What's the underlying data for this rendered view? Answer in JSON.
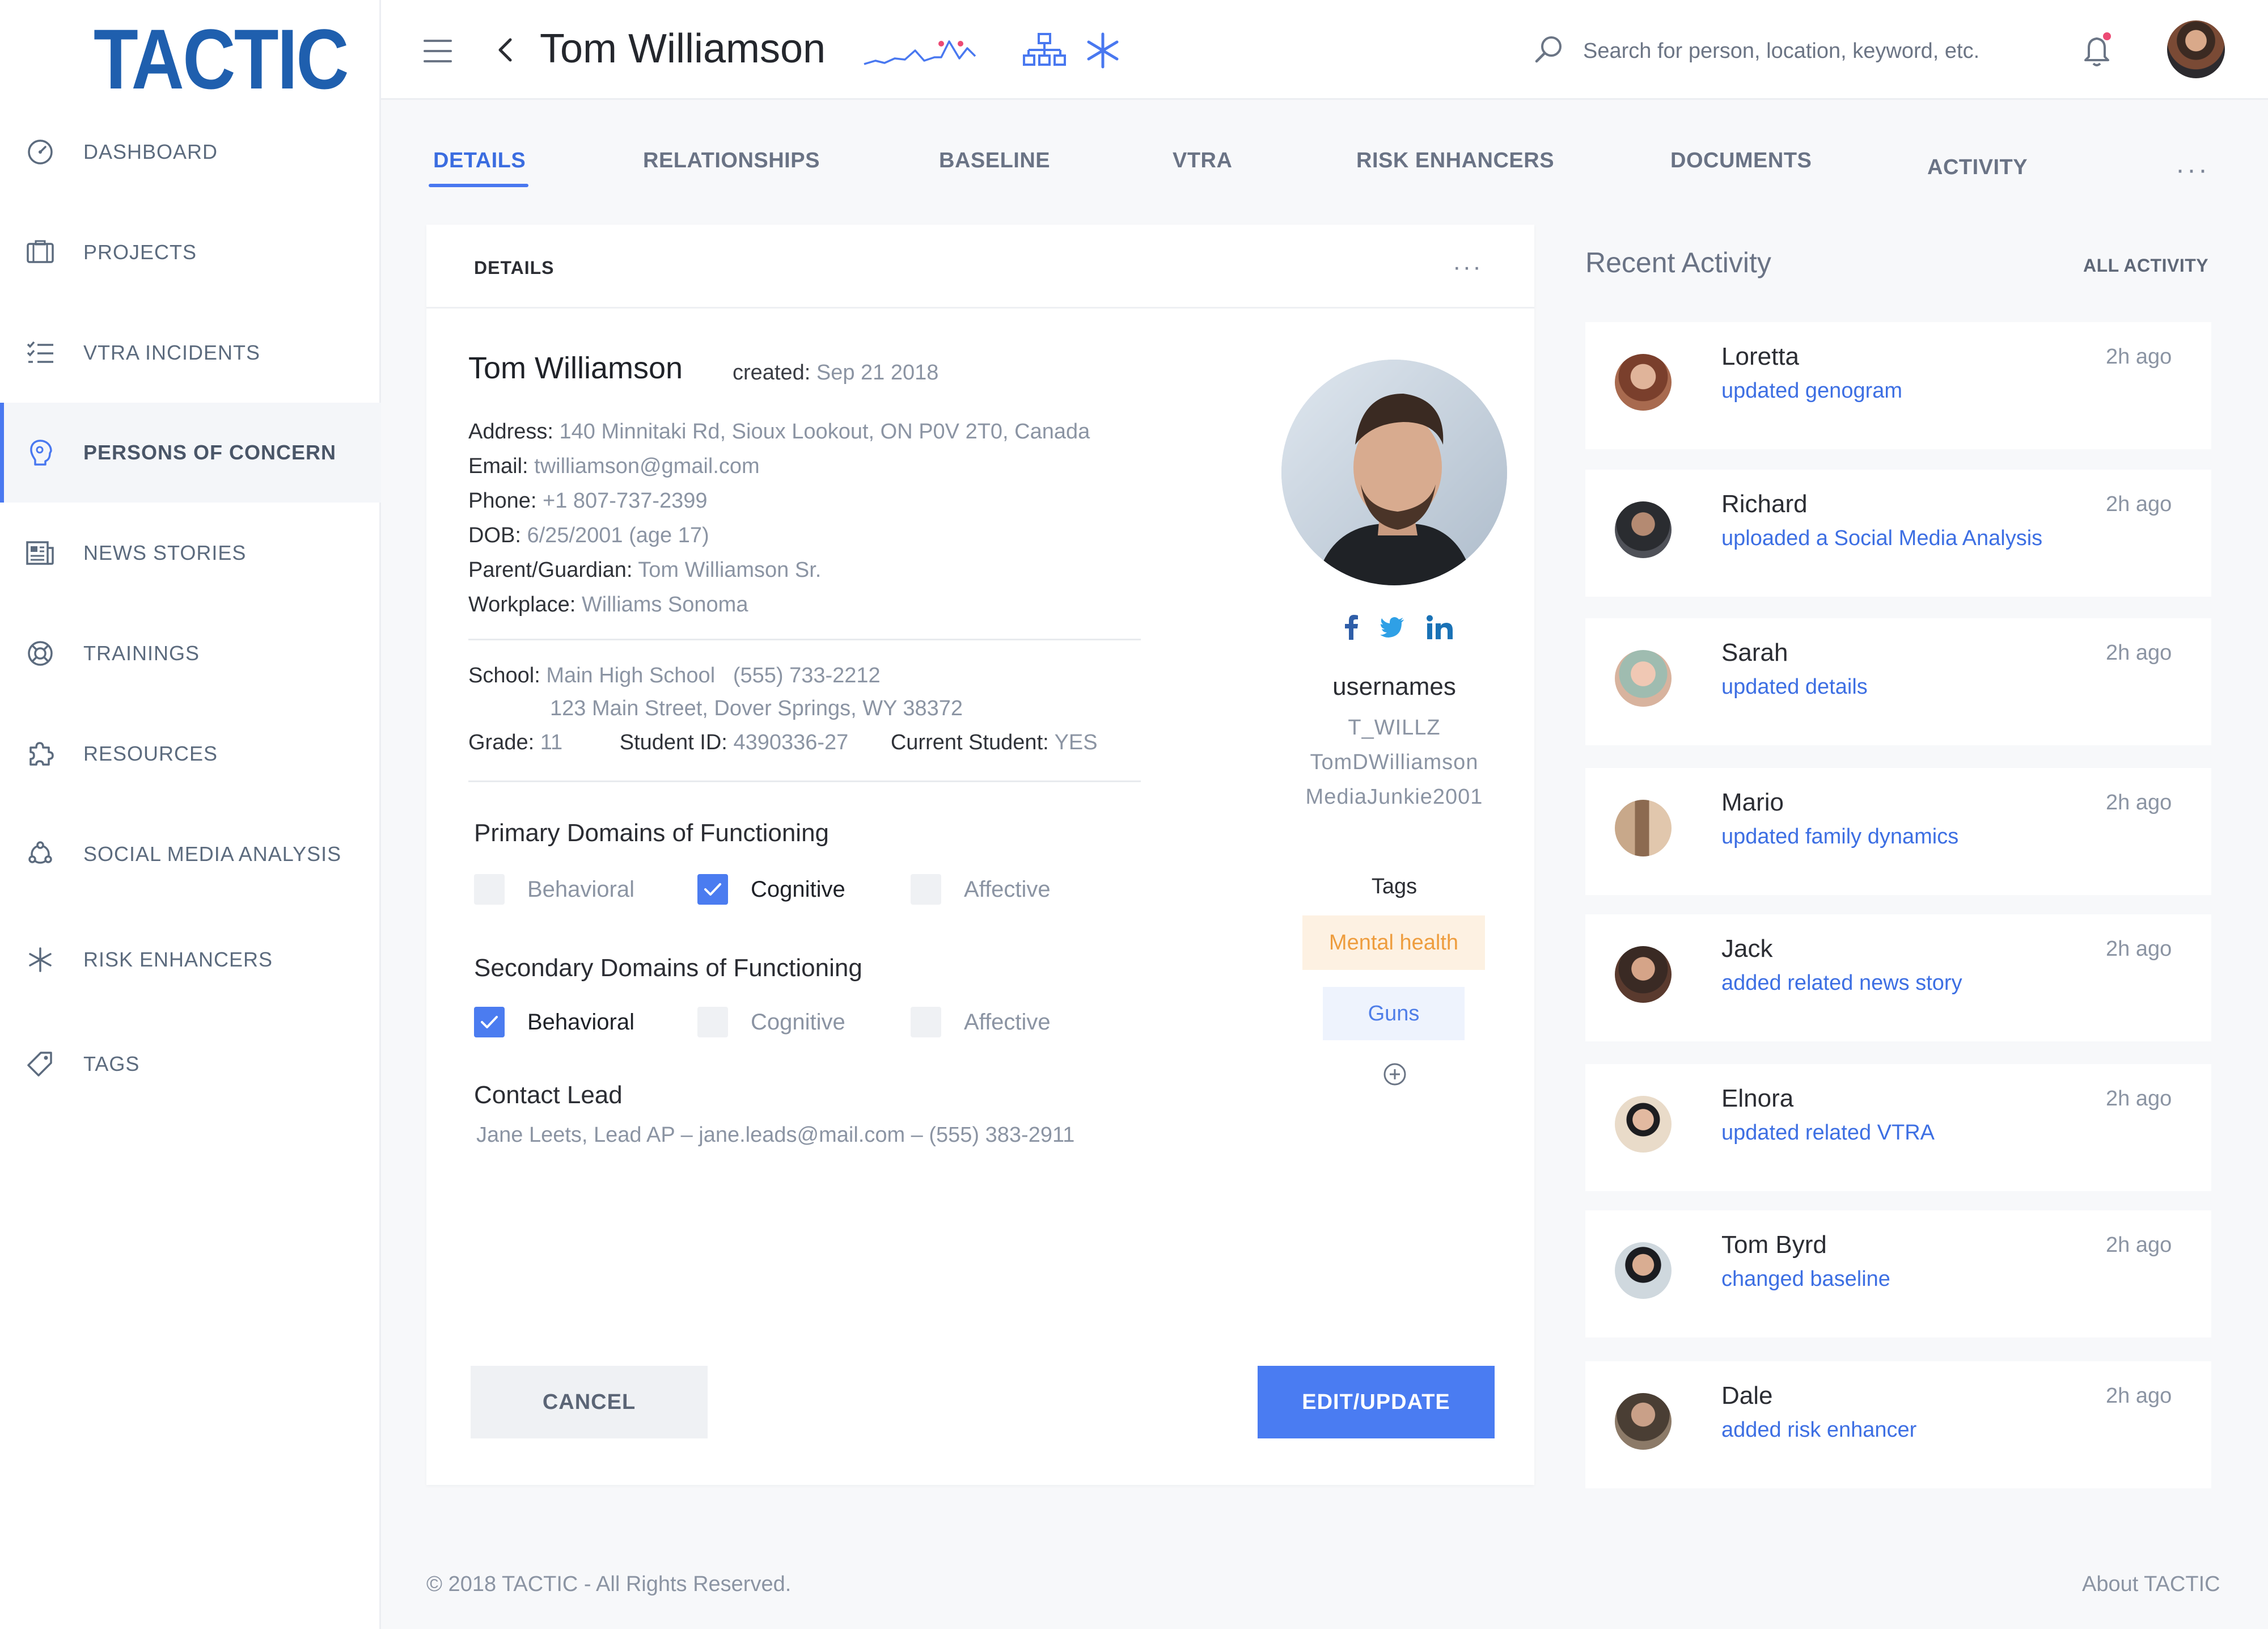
{
  "brand": {
    "logo_text": "TACTIC",
    "color": "#1f5fae"
  },
  "colors": {
    "accent": "#4978f0",
    "link": "#3d6fe3",
    "muted": "#8b94a3"
  },
  "sidebar": {
    "items": [
      {
        "label": "DASHBOARD",
        "icon": "dashboard-gauge-icon"
      },
      {
        "label": "PROJECTS",
        "icon": "projects-icon"
      },
      {
        "label": "VTRA INCIDENTS",
        "icon": "checklist-icon"
      },
      {
        "label": "PERSONS OF CONCERN",
        "icon": "person-head-icon",
        "active": true
      },
      {
        "label": "NEWS STORIES",
        "icon": "newspaper-icon"
      },
      {
        "label": "TRAININGS",
        "icon": "lifebuoy-icon"
      },
      {
        "label": "RESOURCES",
        "icon": "puzzle-icon"
      },
      {
        "label": "SOCIAL MEDIA ANALYSIS",
        "icon": "social-network-icon"
      },
      {
        "label": "RISK ENHANCERS",
        "icon": "asterisk-icon"
      },
      {
        "label": "TAGS",
        "icon": "tag-icon"
      }
    ]
  },
  "header": {
    "title": "Tom Williamson",
    "search_placeholder": "Search for person, location, keyword, etc."
  },
  "tabs": [
    {
      "label": "DETAILS",
      "active": true
    },
    {
      "label": "RELATIONSHIPS"
    },
    {
      "label": "BASELINE"
    },
    {
      "label": "VTRA"
    },
    {
      "label": "RISK ENHANCERS"
    },
    {
      "label": "DOCUMENTS"
    },
    {
      "label": "ACTIVITY"
    }
  ],
  "tabs_more": "···",
  "details": {
    "card_title": "DETAILS",
    "card_more": "···",
    "name": "Tom Williamson",
    "created_label": "created:",
    "created_value": "Sep 21 2018",
    "fields": [
      {
        "label": "Address:",
        "value": "140 Minnitaki Rd, Sioux Lookout, ON P0V 2T0, Canada"
      },
      {
        "label": "Email:",
        "value": "twilliamson@gmail.com"
      },
      {
        "label": "Phone:",
        "value": "+1 807-737-2399"
      },
      {
        "label": "DOB:",
        "value": "6/25/2001 (age 17)"
      },
      {
        "label": "Parent/Guardian:",
        "value": "Tom Williamson Sr."
      },
      {
        "label": "Workplace:",
        "value": "Williams Sonoma"
      }
    ],
    "school": {
      "label": "School:",
      "name": "Main High School",
      "phone": "(555) 733-2212",
      "address": "123 Main Street, Dover Springs, WY 38372",
      "grade_label": "Grade:",
      "grade": "11",
      "student_id_label": "Student ID:",
      "student_id": "4390336-27",
      "current_label": "Current Student:",
      "current": "YES"
    },
    "primary_title": "Primary Domains of Functioning",
    "primary": [
      {
        "label": "Behavioral",
        "checked": false
      },
      {
        "label": "Cognitive",
        "checked": true
      },
      {
        "label": "Affective",
        "checked": false
      }
    ],
    "secondary_title": "Secondary Domains of Functioning",
    "secondary": [
      {
        "label": "Behavioral",
        "checked": true
      },
      {
        "label": "Cognitive",
        "checked": false
      },
      {
        "label": "Affective",
        "checked": false
      }
    ],
    "contact_title": "Contact Lead",
    "contact_value": "Jane Leets, Lead AP – jane.leads@mail.com – (555) 383-2911",
    "cancel_label": "CANCEL",
    "edit_label": "EDIT/UPDATE"
  },
  "profile": {
    "social": [
      "facebook-icon",
      "twitter-icon",
      "linkedin-icon"
    ],
    "usernames_title": "usernames",
    "usernames": [
      "T_WILLZ",
      "TomDWilliamson",
      "MediaJunkie2001"
    ],
    "tags_title": "Tags",
    "tags": [
      "Mental health",
      "Guns"
    ]
  },
  "activity": {
    "title": "Recent Activity",
    "all_label": "ALL ACTIVITY",
    "items": [
      {
        "name": "Loretta",
        "action": "updated genogram",
        "time": "2h ago"
      },
      {
        "name": "Richard",
        "action": "uploaded a Social Media Analysis",
        "time": "2h ago"
      },
      {
        "name": "Sarah",
        "action": "updated details",
        "time": "2h ago"
      },
      {
        "name": "Mario",
        "action": "updated family dynamics",
        "time": "2h ago"
      },
      {
        "name": "Jack",
        "action": "added related news story",
        "time": "2h ago"
      },
      {
        "name": "Elnora",
        "action": "updated related VTRA",
        "time": "2h ago"
      },
      {
        "name": "Tom Byrd",
        "action": "changed baseline",
        "time": "2h ago"
      },
      {
        "name": "Dale",
        "action": "added risk enhancer",
        "time": "2h ago"
      }
    ]
  },
  "footer": {
    "copyright": "© 2018 TACTIC - All Rights Reserved.",
    "about": "About TACTIC"
  }
}
